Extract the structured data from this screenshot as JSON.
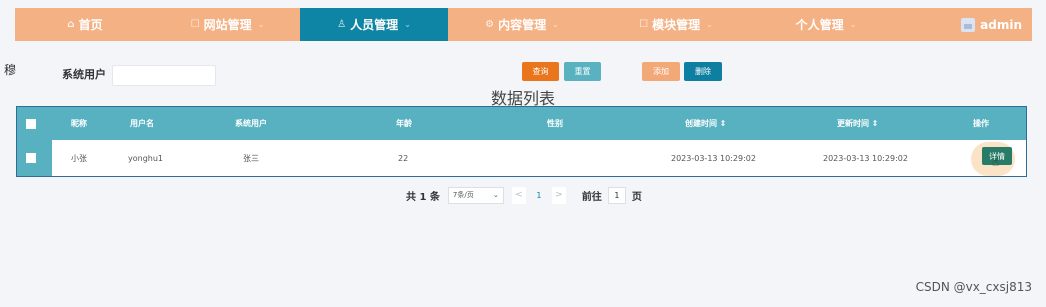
{
  "nav": {
    "items": [
      {
        "label": "首页",
        "icon": "home-icon",
        "glyph": "⌂"
      },
      {
        "label": "网站管理",
        "icon": "doc-icon",
        "glyph": "☐"
      },
      {
        "label": "人员管理",
        "icon": "user-icon",
        "glyph": "♙"
      },
      {
        "label": "内容管理",
        "icon": "gear-icon",
        "glyph": "⚙"
      },
      {
        "label": "模块管理",
        "icon": "doc-icon",
        "glyph": "☐"
      },
      {
        "label": "个人管理",
        "icon": "none",
        "glyph": ""
      }
    ],
    "active_index": 2,
    "admin": "admin",
    "colors": {
      "bar": "#f4b183",
      "active": "#0e85a4"
    }
  },
  "side_char": "穆",
  "filter": {
    "label": "系统用户",
    "value": "",
    "placeholder": ""
  },
  "buttons": {
    "query": "查询",
    "reset": "重置",
    "add": "添加",
    "delete": "删除"
  },
  "list_title": "数据列表",
  "table": {
    "headers": [
      "昵称",
      "用户名",
      "系统用户",
      "年龄",
      "性别",
      "创建时间 ⇕",
      "更新时间 ⇕",
      "操作"
    ],
    "rows": [
      {
        "nickname": "小张",
        "username": "yonghu1",
        "system_user": "张三",
        "age": "22",
        "gender": "",
        "created": "2023-03-13 10:29:02",
        "updated": "2023-03-13 10:29:02",
        "action": "详情"
      }
    ],
    "colors": {
      "header": "#57b1c1",
      "detail_button": "#287c67"
    }
  },
  "pagination": {
    "total": "共 1 条",
    "page_size": "7条/页",
    "prev": "<",
    "current": "1",
    "next": ">",
    "goto_label": "前往",
    "goto_value": "1",
    "page_suffix": "页"
  },
  "watermark": "CSDN @vx_cxsj813"
}
